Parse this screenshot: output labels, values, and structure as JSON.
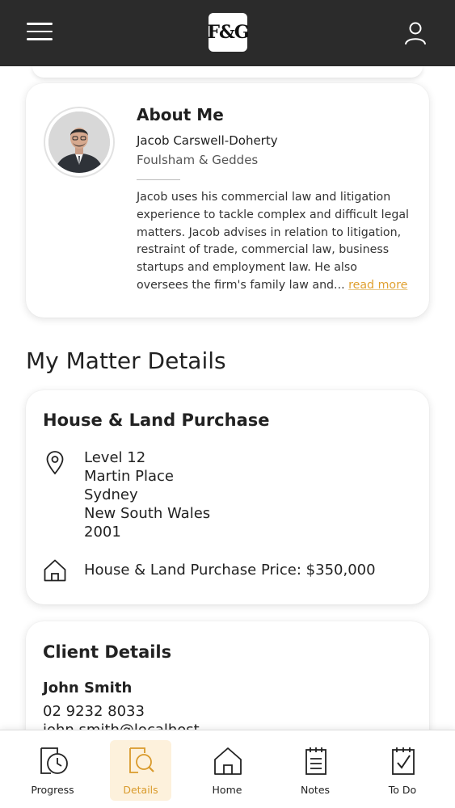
{
  "header": {
    "logo_text": "F&G",
    "menu_icon": "hamburger-menu-icon",
    "profile_icon": "user-profile-icon"
  },
  "about": {
    "title": "About Me",
    "name": "Jacob Carswell-Doherty",
    "firm": "Foulsham & Geddes",
    "bio": "Jacob uses his commercial law and litigation experience to tackle complex and difficult legal matters. Jacob advises in relation to litigation, restraint of trade, commercial law, business startups and employment law. He also oversees the firm's family law and...",
    "read_more": "read more"
  },
  "matter_section": {
    "title": "My Matter Details"
  },
  "matter": {
    "title": "House & Land Purchase",
    "address": [
      "Level 12",
      "Martin Place",
      "Sydney",
      "New South Wales",
      "2001"
    ],
    "price_label": "House & Land Purchase Price: $350,000"
  },
  "client": {
    "title": "Client Details",
    "name": "John Smith",
    "phone": "02 9232 8033",
    "email": "john.smith@localhost"
  },
  "nav": {
    "items": [
      {
        "label": "Progress",
        "icon": "clock-document-icon"
      },
      {
        "label": "Details",
        "icon": "magnifier-document-icon",
        "active": true
      },
      {
        "label": "Home",
        "icon": "home-icon"
      },
      {
        "label": "Notes",
        "icon": "notepad-icon"
      },
      {
        "label": "To Do",
        "icon": "checklist-icon"
      }
    ]
  },
  "colors": {
    "header_bg": "#2b2b2b",
    "accent": "#e0a030",
    "active_tab_bg": "#fdf1dc"
  }
}
